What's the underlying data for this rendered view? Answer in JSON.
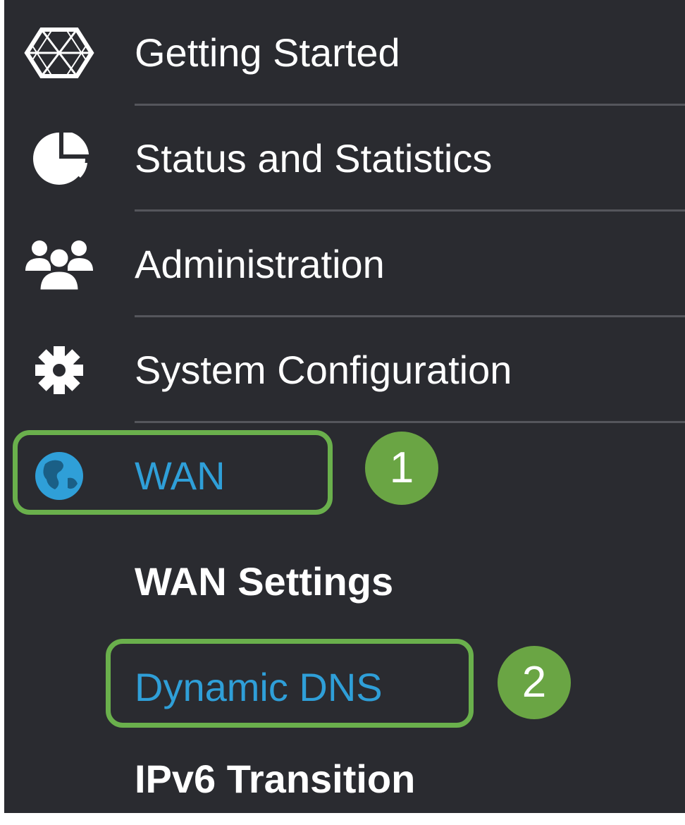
{
  "nav": {
    "items": [
      {
        "label": "Getting Started",
        "icon": "getting-started-icon"
      },
      {
        "label": "Status and Statistics",
        "icon": "pie-chart-icon"
      },
      {
        "label": "Administration",
        "icon": "users-icon"
      },
      {
        "label": "System Configuration",
        "icon": "gear-icon"
      },
      {
        "label": "WAN",
        "icon": "globe-icon",
        "active": true
      }
    ],
    "wan_submenu": [
      {
        "label": "WAN Settings"
      },
      {
        "label": "Dynamic DNS",
        "active": true
      },
      {
        "label": "IPv6 Transition"
      }
    ]
  },
  "callouts": {
    "step1": "1",
    "step2": "2"
  },
  "colors": {
    "background": "#2a2b30",
    "active_text": "#2f9fd8",
    "callout_green": "#6aa544"
  }
}
